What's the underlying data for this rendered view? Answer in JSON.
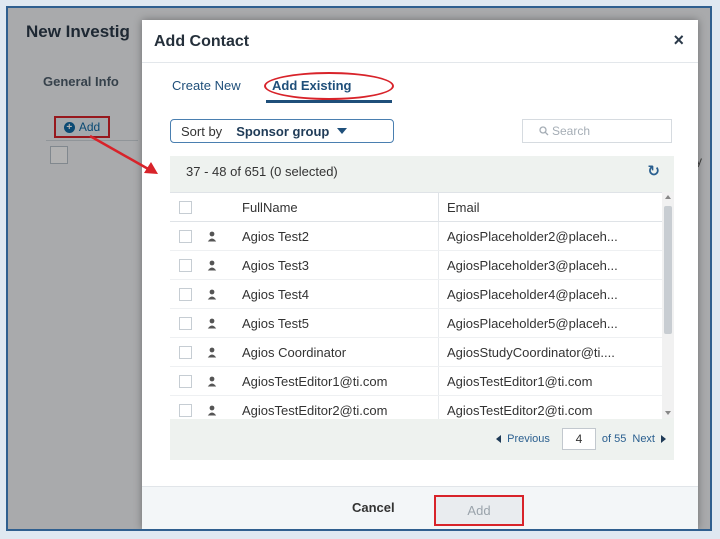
{
  "background": {
    "title": "New Investig",
    "tab": "General Info",
    "add_button": "Add",
    "stub_char": "y"
  },
  "modal": {
    "title": "Add Contact",
    "close": "×",
    "tabs": {
      "create_new": "Create New",
      "add_existing": "Add Existing"
    },
    "sort": {
      "label": "Sort by",
      "value": "Sponsor group"
    },
    "search": {
      "placeholder": "Search"
    },
    "count": "37 - 48 of 651 (0 selected)",
    "columns": {
      "name": "FullName",
      "email": "Email"
    },
    "rows": [
      {
        "name": "Agios Test2",
        "email": "AgiosPlaceholder2@placeh..."
      },
      {
        "name": "Agios Test3",
        "email": "AgiosPlaceholder3@placeh..."
      },
      {
        "name": "Agios Test4",
        "email": "AgiosPlaceholder4@placeh..."
      },
      {
        "name": "Agios Test5",
        "email": "AgiosPlaceholder5@placeh..."
      },
      {
        "name": "Agios Coordinator",
        "email": "AgiosStudyCoordinator@ti...."
      },
      {
        "name": "AgiosTestEditor1@ti.com",
        "email": "AgiosTestEditor1@ti.com"
      },
      {
        "name": "AgiosTestEditor2@ti.com",
        "email": "AgiosTestEditor2@ti.com"
      }
    ],
    "pager": {
      "previous": "Previous",
      "page": "4",
      "of": "of 55",
      "next": "Next"
    },
    "footer": {
      "cancel": "Cancel",
      "add": "Add"
    }
  },
  "colors": {
    "highlight": "#d8232a",
    "accent": "#1f4f7a",
    "link": "#2a5f8f"
  },
  "icons": [
    "close-icon",
    "caret-down-icon",
    "search-icon",
    "refresh-icon",
    "person-icon",
    "plus-circle-icon",
    "prev-arrow-icon",
    "next-arrow-icon"
  ]
}
